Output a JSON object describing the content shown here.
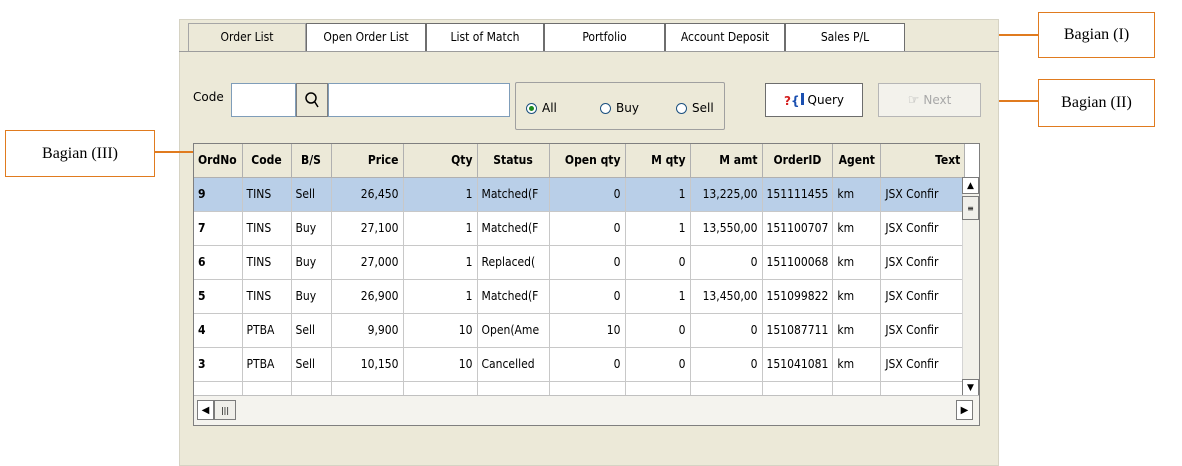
{
  "tabs": [
    "Order List",
    "Open Order List",
    "List of Match",
    "Portfolio",
    "Account Deposit",
    "Sales P/L"
  ],
  "active_tab": 0,
  "code_label": "Code",
  "code_value": "",
  "radios": [
    {
      "label": "All",
      "checked": true
    },
    {
      "label": "Buy",
      "checked": false
    },
    {
      "label": "Sell",
      "checked": false
    }
  ],
  "query_label": "Query",
  "next_label": "Next",
  "columns": [
    "OrdNo",
    "Code",
    "B/S",
    "Price",
    "Qty",
    "Status",
    "Open qty",
    "M qty",
    "M amt",
    "OrderID",
    "Agent",
    "Text"
  ],
  "rows": [
    [
      "9",
      "TINS",
      "Sell",
      "26,450",
      "1",
      "Matched(F",
      "0",
      "1",
      "13,225,00",
      "151111455",
      "km",
      "JSX Confir"
    ],
    [
      "7",
      "TINS",
      "Buy",
      "27,100",
      "1",
      "Matched(F",
      "0",
      "1",
      "13,550,00",
      "151100707",
      "km",
      "JSX Confir"
    ],
    [
      "6",
      "TINS",
      "Buy",
      "27,000",
      "1",
      "Replaced(",
      "0",
      "0",
      "0",
      "151100068",
      "km",
      "JSX Confir"
    ],
    [
      "5",
      "TINS",
      "Buy",
      "26,900",
      "1",
      "Matched(F",
      "0",
      "1",
      "13,450,00",
      "151099822",
      "km",
      "JSX Confir"
    ],
    [
      "4",
      "PTBA",
      "Sell",
      "9,900",
      "10",
      "Open(Ame",
      "10",
      "0",
      "0",
      "151087711",
      "km",
      "JSX Confir"
    ],
    [
      "3",
      "PTBA",
      "Sell",
      "10,150",
      "10",
      "Cancelled",
      "0",
      "0",
      "0",
      "151041081",
      "km",
      "JSX Confir"
    ]
  ],
  "selected_row": 0,
  "annotations": {
    "part1": "Bagian (I)",
    "part2": "Bagian (II)",
    "part3": "Bagian (III)"
  },
  "colors": {
    "callout_orange": "#e07b1f",
    "selected_row": "#b9cfe8",
    "panel_bg": "#ece9d8"
  }
}
